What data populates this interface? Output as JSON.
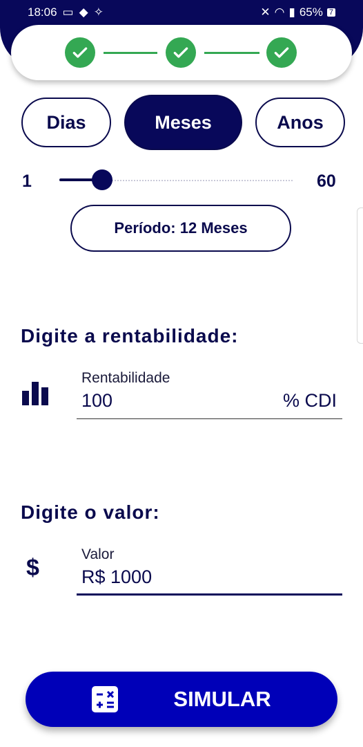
{
  "status_bar": {
    "time": "18:06",
    "battery": "65%",
    "battery_indicator": "7"
  },
  "stepper": {
    "steps": [
      {
        "state": "completed",
        "icon": "check-icon"
      },
      {
        "state": "completed",
        "icon": "check-icon"
      },
      {
        "state": "completed",
        "icon": "check-icon"
      }
    ],
    "color": "#34a853"
  },
  "period_units": {
    "options": [
      "Dias",
      "Meses",
      "Anos"
    ],
    "selected": "Meses"
  },
  "slider": {
    "min_label": "1",
    "max_label": "60",
    "value": 12
  },
  "period_display": "Período: 12 Meses",
  "profitability": {
    "section_title": "Digite a rentabilidade:",
    "label": "Rentabilidade",
    "value": "100",
    "suffix": "% CDI",
    "icon": "bar-chart-icon"
  },
  "amount": {
    "section_title": "Digite o valor:",
    "label": "Valor",
    "value": "R$ 1000",
    "icon": "dollar-icon"
  },
  "simulate_button": {
    "label": "SIMULAR",
    "icon": "calculator-icon"
  },
  "colors": {
    "primary_dark": "#08085a",
    "button_blue": "#0000b8",
    "success_green": "#34a853"
  }
}
